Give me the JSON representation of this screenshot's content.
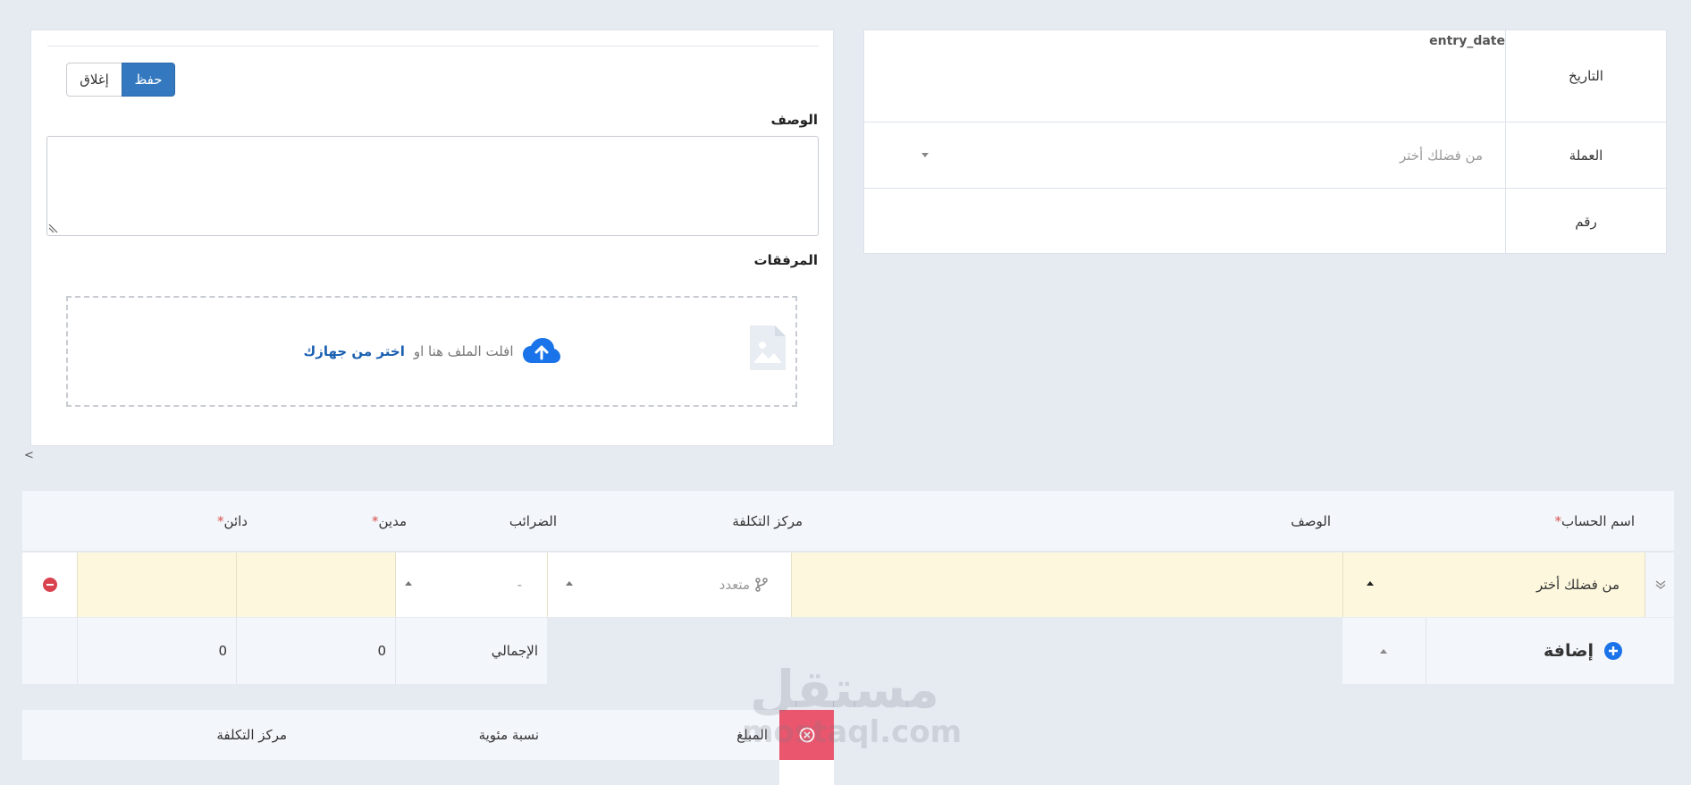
{
  "actions": {
    "close_label": "إغلاق",
    "save_label": "حفظ"
  },
  "notes": {
    "description_label": "الوصف",
    "attachments_label": "المرفقات",
    "dropzone_text": "افلت الملف هنا او",
    "dropzone_link": "اختر من جهازك"
  },
  "info": {
    "date_label": "التاريخ",
    "entry_date_placeholder": "entry_date",
    "currency_label": "العملة",
    "currency_placeholder": "من فضلك أختر",
    "number_label": "رقم"
  },
  "collapse_toggle": "<",
  "lines": {
    "columns": {
      "account": "اسم الحساب",
      "description": "الوصف",
      "cost_center": "مركز التكلفة",
      "taxes": "الضرائب",
      "debit": "مدين",
      "credit": "دائن"
    },
    "required_mark": "*",
    "row": {
      "account_placeholder": "من فضلك أختر",
      "cost_center_value": "متعدد",
      "tax_value": "-"
    },
    "add_label": "إضافة",
    "total_label": "الإجمالي",
    "total_debit": "0",
    "total_credit": "0"
  },
  "cost_centers": {
    "amount_label": "المبلغ",
    "percent_label": "نسبة مئوية",
    "cost_center_label": "مركز التكلفة"
  },
  "watermark": {
    "arabic": "مستقل",
    "latin": "mostaql.com"
  },
  "colors": {
    "primary": "#3479bf",
    "danger": "#e9566e",
    "highlight_row": "#fdf8dd",
    "add_icon": "#1a73e8"
  }
}
